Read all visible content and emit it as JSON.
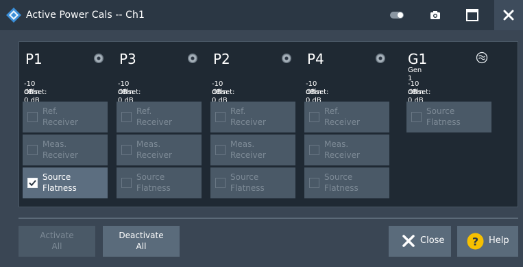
{
  "window": {
    "title": "Active Power Cals -- Ch1",
    "icons": [
      "rs-logo-icon",
      "toggle-icon",
      "camera-icon",
      "maximize-icon",
      "close-icon"
    ]
  },
  "ports": [
    {
      "name": "P1",
      "power": "-10 dBm",
      "offset": "Offset: 0 dB",
      "icon": "port-connector-icon",
      "buttons": [
        {
          "label1": "Ref.",
          "label2": "Receiver",
          "checked": false
        },
        {
          "label1": "Meas.",
          "label2": "Receiver",
          "checked": false
        },
        {
          "label1": "Source",
          "label2": "Flatness",
          "checked": true
        }
      ]
    },
    {
      "name": "P3",
      "power": "-10 dBm",
      "offset": "Offset: 0 dB",
      "icon": "port-connector-icon",
      "buttons": [
        {
          "label1": "Ref.",
          "label2": "Receiver",
          "checked": false
        },
        {
          "label1": "Meas.",
          "label2": "Receiver",
          "checked": false
        },
        {
          "label1": "Source",
          "label2": "Flatness",
          "checked": false
        }
      ]
    },
    {
      "name": "P2",
      "power": "-10 dBm",
      "offset": "Offset: 0 dB",
      "icon": "port-connector-icon",
      "buttons": [
        {
          "label1": "Ref.",
          "label2": "Receiver",
          "checked": false
        },
        {
          "label1": "Meas.",
          "label2": "Receiver",
          "checked": false
        },
        {
          "label1": "Source",
          "label2": "Flatness",
          "checked": false
        }
      ]
    },
    {
      "name": "P4",
      "power": "-10 dBm",
      "offset": "Offset: 0 dB",
      "icon": "port-connector-icon",
      "buttons": [
        {
          "label1": "Ref.",
          "label2": "Receiver",
          "checked": false
        },
        {
          "label1": "Meas.",
          "label2": "Receiver",
          "checked": false
        },
        {
          "label1": "Source",
          "label2": "Flatness",
          "checked": false
        }
      ]
    }
  ],
  "generator": {
    "name": "G1",
    "subname": "Gen 1",
    "power": "-10 dBm",
    "offset": "Offset: 0 dB",
    "icon": "signal-generator-icon",
    "button": {
      "label1": "Source",
      "label2": "Flatness",
      "checked": false
    }
  },
  "footer": {
    "activate_line1": "Activate",
    "activate_line2": "All",
    "deactivate_line1": "Deactivate",
    "deactivate_line2": "All",
    "close_label": "Close",
    "help_label": "Help"
  },
  "colors": {
    "title_bar": "#2b3744",
    "dialog_bg": "#3a4654",
    "panel_bg": "#1f2933",
    "button_disabled": "#4a5967",
    "button_active": "#5c6e80",
    "help_icon": "#f6c000"
  }
}
